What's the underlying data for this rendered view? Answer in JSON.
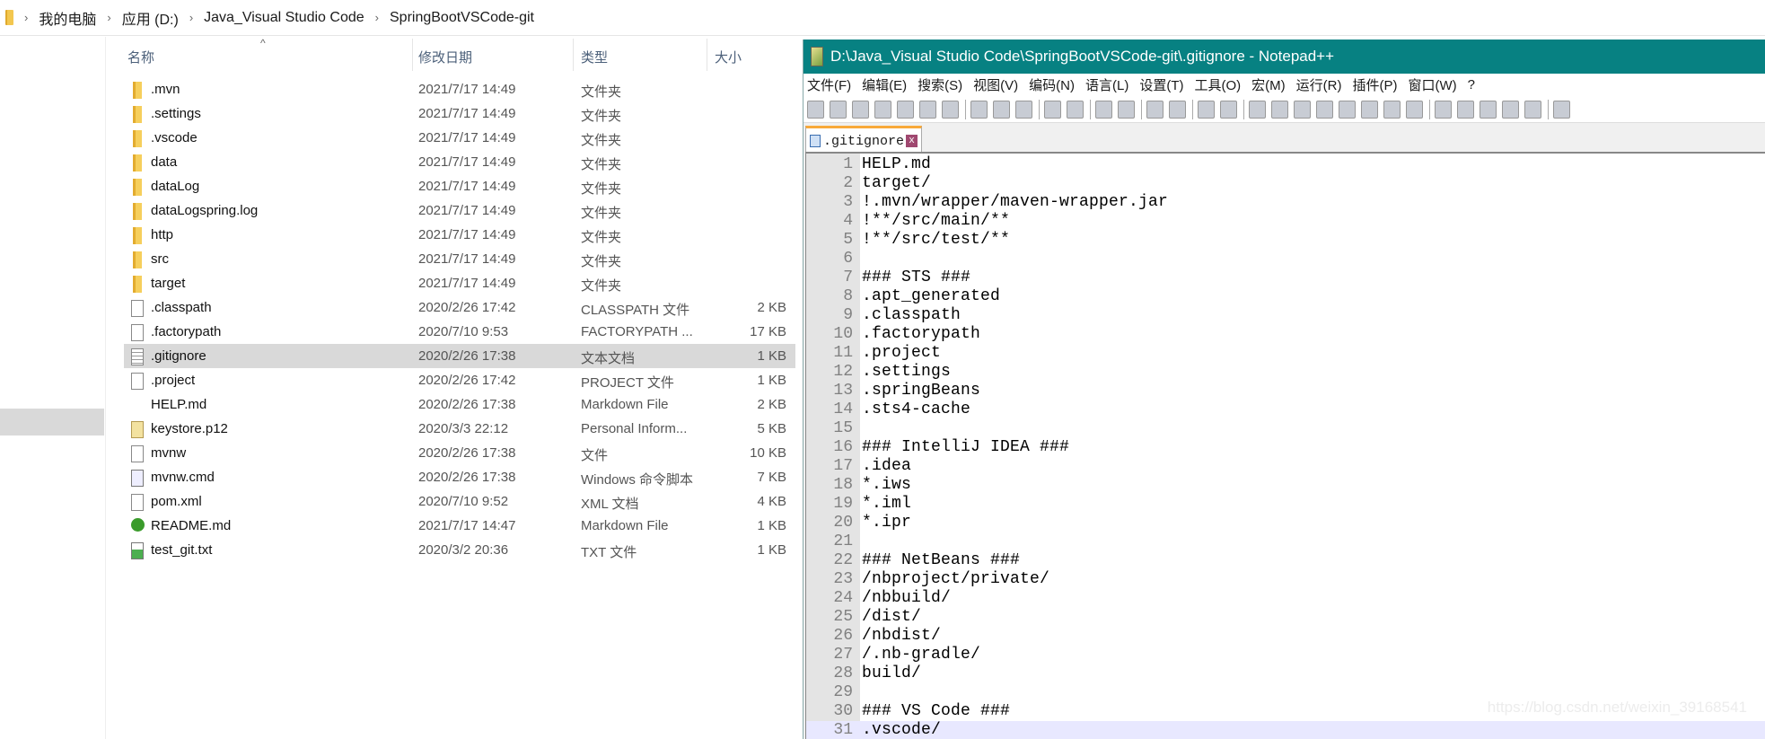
{
  "breadcrumb": [
    "我的电脑",
    "应用 (D:)",
    "Java_Visual Studio Code",
    "SpringBootVSCode-git"
  ],
  "explorer": {
    "columns": {
      "name": "名称",
      "date": "修改日期",
      "type": "类型",
      "size": "大小"
    },
    "files": [
      {
        "name": ".mvn",
        "date": "2021/7/17 14:49",
        "type": "文件夹",
        "size": "",
        "icon": "folder"
      },
      {
        "name": ".settings",
        "date": "2021/7/17 14:49",
        "type": "文件夹",
        "size": "",
        "icon": "folder"
      },
      {
        "name": ".vscode",
        "date": "2021/7/17 14:49",
        "type": "文件夹",
        "size": "",
        "icon": "folder"
      },
      {
        "name": "data",
        "date": "2021/7/17 14:49",
        "type": "文件夹",
        "size": "",
        "icon": "folder"
      },
      {
        "name": "dataLog",
        "date": "2021/7/17 14:49",
        "type": "文件夹",
        "size": "",
        "icon": "folder"
      },
      {
        "name": "dataLogspring.log",
        "date": "2021/7/17 14:49",
        "type": "文件夹",
        "size": "",
        "icon": "folder"
      },
      {
        "name": "http",
        "date": "2021/7/17 14:49",
        "type": "文件夹",
        "size": "",
        "icon": "folder"
      },
      {
        "name": "src",
        "date": "2021/7/17 14:49",
        "type": "文件夹",
        "size": "",
        "icon": "folder"
      },
      {
        "name": "target",
        "date": "2021/7/17 14:49",
        "type": "文件夹",
        "size": "",
        "icon": "folder"
      },
      {
        "name": ".classpath",
        "date": "2020/2/26 17:42",
        "type": "CLASSPATH 文件",
        "size": "2 KB",
        "icon": "file"
      },
      {
        "name": ".factorypath",
        "date": "2020/7/10 9:53",
        "type": "FACTORYPATH ...",
        "size": "17 KB",
        "icon": "file"
      },
      {
        "name": ".gitignore",
        "date": "2020/2/26 17:38",
        "type": "文本文档",
        "size": "1 KB",
        "icon": "text",
        "selected": true
      },
      {
        "name": ".project",
        "date": "2020/2/26 17:42",
        "type": "PROJECT 文件",
        "size": "1 KB",
        "icon": "file"
      },
      {
        "name": "HELP.md",
        "date": "2020/2/26 17:38",
        "type": "Markdown File",
        "size": "2 KB",
        "icon": "md"
      },
      {
        "name": "keystore.p12",
        "date": "2020/3/3 22:12",
        "type": "Personal Inform...",
        "size": "5 KB",
        "icon": "key"
      },
      {
        "name": "mvnw",
        "date": "2020/2/26 17:38",
        "type": "文件",
        "size": "10 KB",
        "icon": "file"
      },
      {
        "name": "mvnw.cmd",
        "date": "2020/2/26 17:38",
        "type": "Windows 命令脚本",
        "size": "7 KB",
        "icon": "cmd"
      },
      {
        "name": "pom.xml",
        "date": "2020/7/10 9:52",
        "type": "XML 文档",
        "size": "4 KB",
        "icon": "file"
      },
      {
        "name": "README.md",
        "date": "2021/7/17 14:47",
        "type": "Markdown File",
        "size": "1 KB",
        "icon": "readme"
      },
      {
        "name": "test_git.txt",
        "date": "2020/3/2 20:36",
        "type": "TXT 文件",
        "size": "1 KB",
        "icon": "txt"
      }
    ]
  },
  "notepad": {
    "title": "D:\\Java_Visual Studio Code\\SpringBootVSCode-git\\.gitignore - Notepad++",
    "accent": "#078182",
    "menu": [
      "文件(F)",
      "编辑(E)",
      "搜索(S)",
      "视图(V)",
      "编码(N)",
      "语言(L)",
      "设置(T)",
      "工具(O)",
      "宏(M)",
      "运行(R)",
      "插件(P)",
      "窗口(W)",
      "?"
    ],
    "toolbar": [
      "new-file-icon",
      "open-file-icon",
      "save-icon",
      "save-all-icon",
      "close-icon",
      "close-all-icon",
      "print-icon",
      "|",
      "cut-icon",
      "copy-icon",
      "paste-icon",
      "|",
      "undo-icon",
      "redo-icon",
      "|",
      "find-icon",
      "replace-icon",
      "|",
      "zoom-in-icon",
      "zoom-out-icon",
      "|",
      "sync-vertical-icon",
      "sync-horizontal-icon",
      "|",
      "word-wrap-icon",
      "show-all-chars-icon",
      "indent-guide-icon",
      "udl-icon",
      "doc-map-icon",
      "function-list-icon",
      "folder-workspace-icon",
      "monitor-icon",
      "|",
      "record-macro-icon",
      "stop-record-icon",
      "play-macro-icon",
      "run-macro-multiple-icon",
      "save-macro-icon",
      "|",
      "spell-check-icon"
    ],
    "tab": ".gitignore",
    "lines": [
      "HELP.md",
      "target/",
      "!.mvn/wrapper/maven-wrapper.jar",
      "!**/src/main/**",
      "!**/src/test/**",
      "",
      "### STS ###",
      ".apt_generated",
      ".classpath",
      ".factorypath",
      ".project",
      ".settings",
      ".springBeans",
      ".sts4-cache",
      "",
      "### IntelliJ IDEA ###",
      ".idea",
      "*.iws",
      "*.iml",
      "*.ipr",
      "",
      "### NetBeans ###",
      "/nbproject/private/",
      "/nbbuild/",
      "/dist/",
      "/nbdist/",
      "/.nb-gradle/",
      "build/",
      "",
      "### VS Code ###",
      ".vscode/"
    ],
    "current_line": 31
  },
  "watermark": "https://blog.csdn.net/weixin_39168541"
}
